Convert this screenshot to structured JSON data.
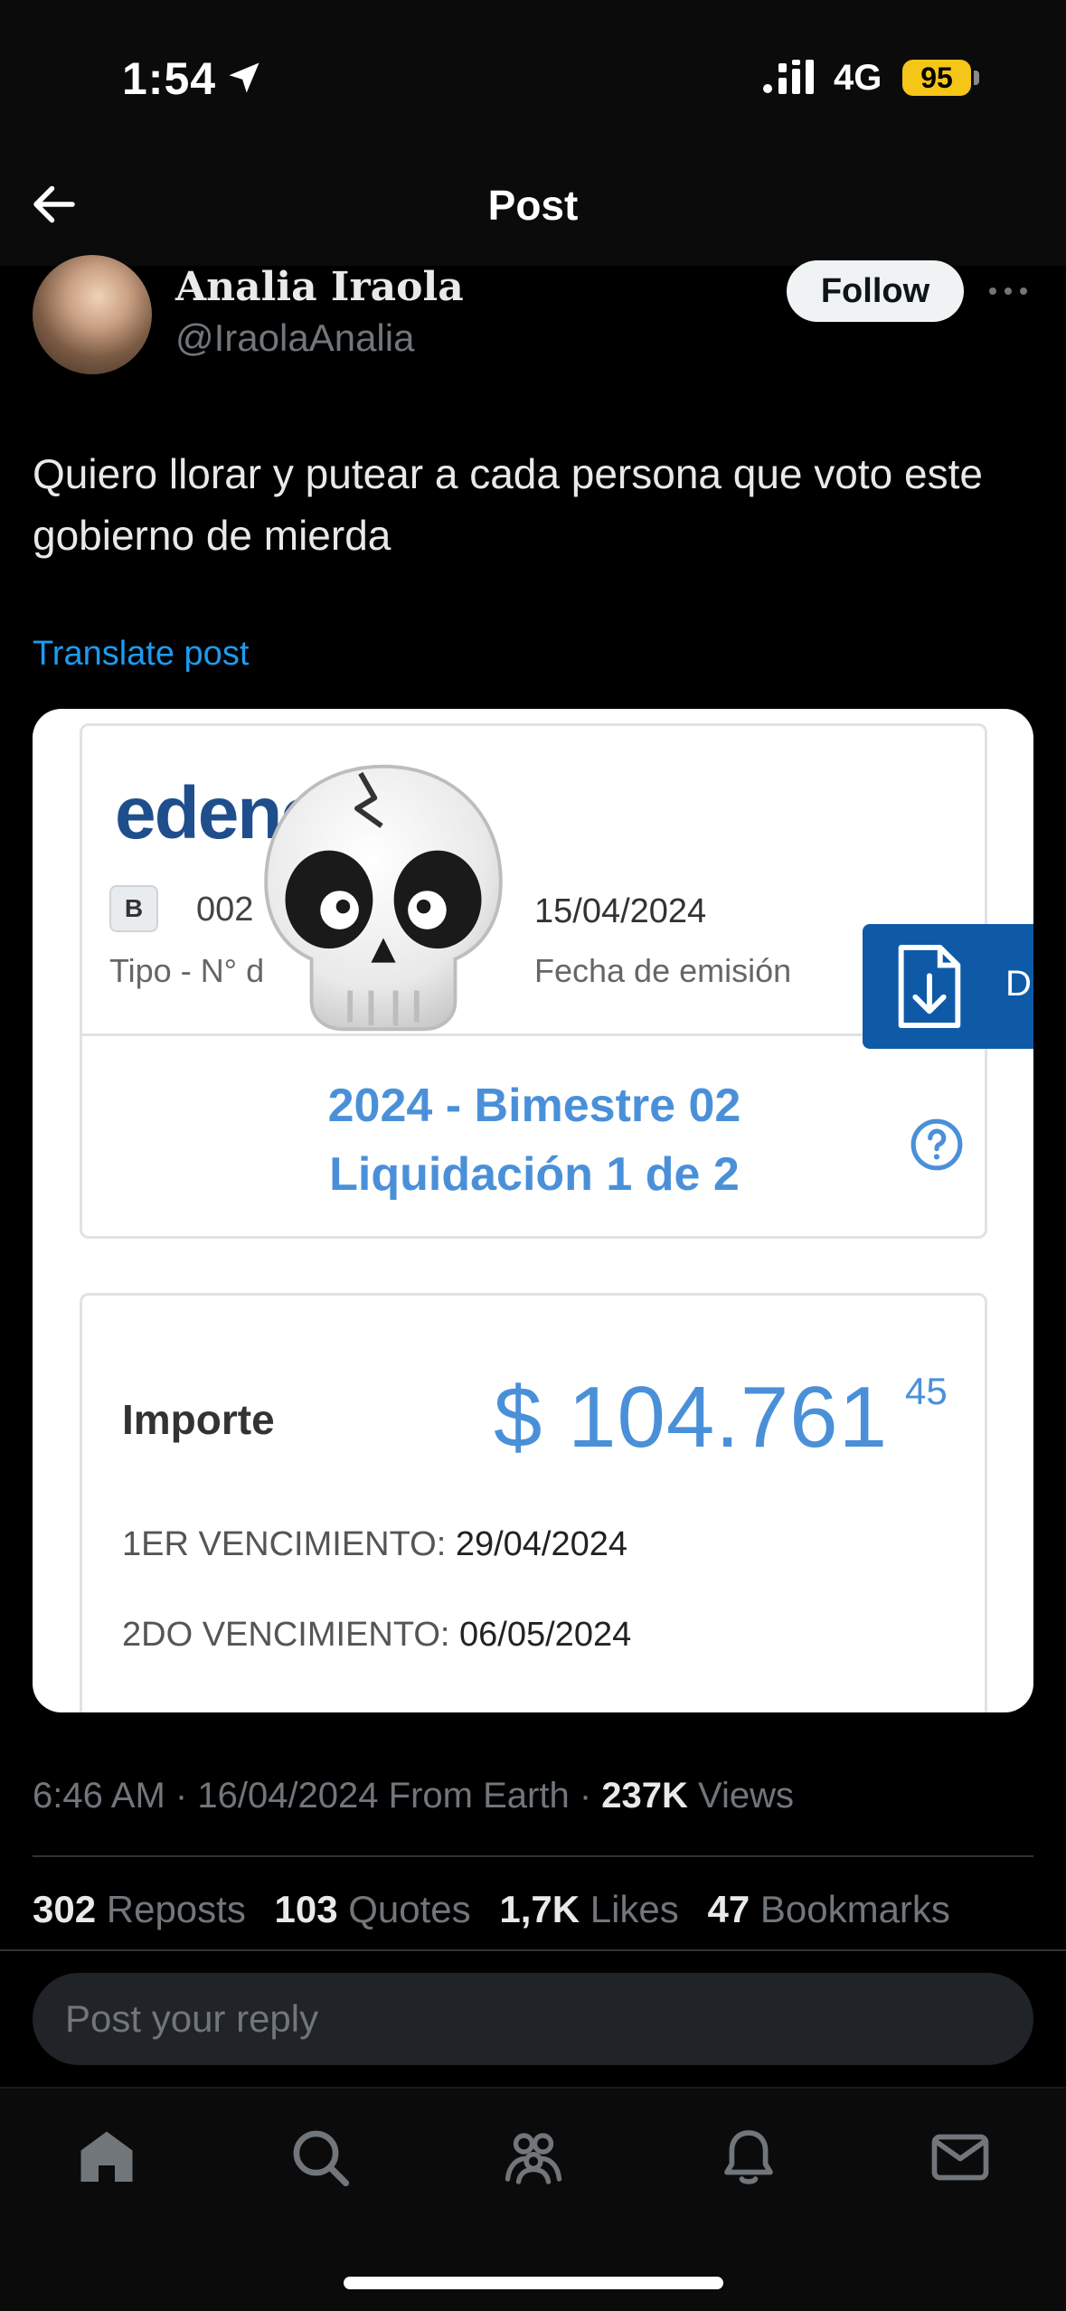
{
  "status_bar": {
    "time": "1:54",
    "network": "4G",
    "battery": "95"
  },
  "header": {
    "title": "Post"
  },
  "author": {
    "display_name": "Analia Iraola",
    "handle": "@IraolaAnalia",
    "follow_label": "Follow"
  },
  "post": {
    "text": "Quiero llorar y putear a cada persona que voto este gobierno de mierda",
    "translate_label": "Translate post"
  },
  "media": {
    "logo_text": "edenor",
    "doc_type_badge": "B",
    "doc_number_partial": "002",
    "doc_type_label": "Tipo - N° d",
    "issue_date": "15/04/2024",
    "issue_date_label": "Fecha de emisión",
    "download_label": "D",
    "period_line1": "2024 - Bimestre 02",
    "period_line2": "Liquidación 1 de 2",
    "amount_label": "Importe",
    "amount_value": "$ 104.761",
    "amount_cents": "45",
    "due1_label": "1ER VENCIMIENTO:",
    "due1_value": "29/04/2024",
    "due2_label": "2DO VENCIMIENTO:",
    "due2_value": "06/05/2024"
  },
  "meta": {
    "time": "6:46 AM",
    "date": "16/04/2024",
    "source": "From Earth",
    "views_count": "237K",
    "views_label": "Views"
  },
  "stats": {
    "reposts_count": "302",
    "reposts_label": "Reposts",
    "quotes_count": "103",
    "quotes_label": "Quotes",
    "likes_count": "1,7K",
    "likes_label": "Likes",
    "bookmarks_count": "47",
    "bookmarks_label": "Bookmarks"
  },
  "reply": {
    "placeholder": "Post your reply"
  },
  "tab_bar": {
    "icons": [
      "home-icon",
      "search-icon",
      "communities-icon",
      "notifications-icon",
      "messages-icon"
    ]
  },
  "colors": {
    "accent": "#1d9bf0",
    "invoice_blue": "#4a90d9",
    "edenor_blue": "#1f4e8c",
    "battery": "#f5c518"
  }
}
